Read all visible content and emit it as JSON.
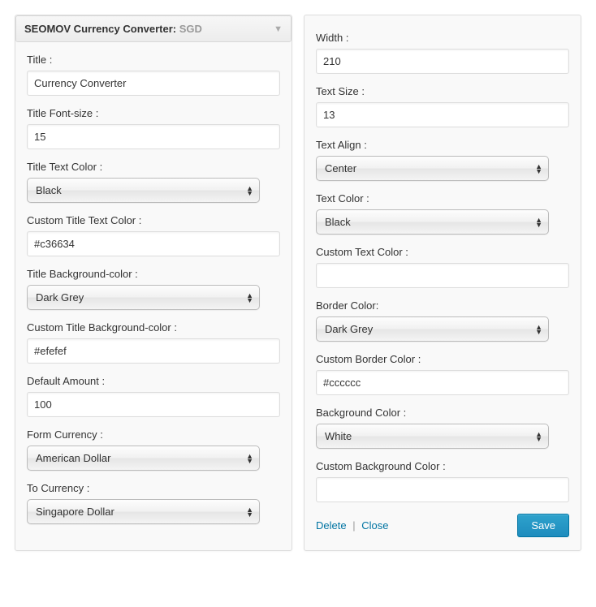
{
  "header": {
    "title_prefix": "SEOMOV Currency Converter",
    "title_sep": ":",
    "title_suffix": "SGD"
  },
  "left": {
    "title_label": "Title :",
    "title_value": "Currency Converter",
    "title_font_size_label": "Title Font-size :",
    "title_font_size_value": "15",
    "title_text_color_label": "Title Text Color :",
    "title_text_color_value": "Black",
    "custom_title_text_color_label": "Custom Title Text Color :",
    "custom_title_text_color_value": "#c36634",
    "title_bg_color_label": "Title Background-color :",
    "title_bg_color_value": "Dark Grey",
    "custom_title_bg_color_label": "Custom Title Background-color :",
    "custom_title_bg_color_value": "#efefef",
    "default_amount_label": "Default Amount :",
    "default_amount_value": "100",
    "form_currency_label": "Form Currency :",
    "form_currency_value": "American Dollar",
    "to_currency_label": "To Currency :",
    "to_currency_value": "Singapore Dollar"
  },
  "right": {
    "width_label": "Width :",
    "width_value": "210",
    "text_size_label": "Text Size :",
    "text_size_value": "13",
    "text_align_label": "Text Align :",
    "text_align_value": "Center",
    "text_color_label": "Text Color :",
    "text_color_value": "Black",
    "custom_text_color_label": "Custom Text Color :",
    "custom_text_color_value": "",
    "border_color_label": "Border Color:",
    "border_color_value": "Dark Grey",
    "custom_border_color_label": "Custom Border Color :",
    "custom_border_color_value": "#cccccc",
    "background_color_label": "Background Color :",
    "background_color_value": "White",
    "custom_bg_color_label": "Custom Background Color :",
    "custom_bg_color_value": ""
  },
  "footer": {
    "delete_label": "Delete",
    "separator": "|",
    "close_label": "Close",
    "save_label": "Save"
  }
}
